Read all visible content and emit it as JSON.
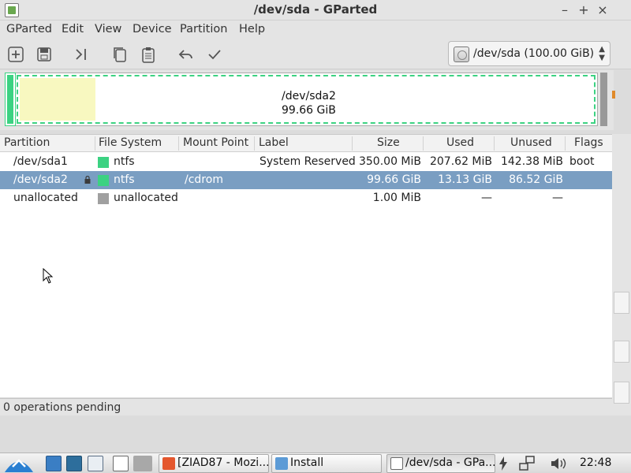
{
  "window": {
    "title": "/dev/sda - GParted",
    "buttons": [
      "–",
      "+",
      "×"
    ]
  },
  "menu": [
    "GParted",
    "Edit",
    "View",
    "Device",
    "Partition",
    "Help"
  ],
  "toolbar_icons": [
    "new-partition-icon",
    "delete-icon",
    "resize-icon",
    "copy-icon",
    "paste-icon",
    "undo-icon",
    "apply-icon"
  ],
  "device": {
    "selected": "/dev/sda  (100.00 GiB)"
  },
  "graphic": {
    "partition": "/dev/sda2",
    "size": "99.66 GiB",
    "used_fraction": 0.1317,
    "fill_color": "#f8f8c0",
    "border_color": "#3cd282"
  },
  "columns": [
    "Partition",
    "File System",
    "Mount Point",
    "Label",
    "Size",
    "Used",
    "Unused",
    "Flags"
  ],
  "rows": [
    {
      "partition": "/dev/sda1",
      "fs": "ntfs",
      "fs_color": "#3cd282",
      "mount": "",
      "label": "System Reserved",
      "size": "350.00 MiB",
      "used": "207.62 MiB",
      "unused": "142.38 MiB",
      "flags": "boot",
      "selected": false,
      "locked": false
    },
    {
      "partition": "/dev/sda2",
      "fs": "ntfs",
      "fs_color": "#3cd282",
      "mount": "/cdrom",
      "label": "",
      "size": "99.66 GiB",
      "used": "13.13 GiB",
      "unused": "86.52 GiB",
      "flags": "",
      "selected": true,
      "locked": true
    },
    {
      "partition": "unallocated",
      "fs": "unallocated",
      "fs_color": "#a0a0a0",
      "mount": "",
      "label": "",
      "size": "1.00 MiB",
      "used": "—",
      "unused": "—",
      "flags": "",
      "selected": false,
      "locked": false
    }
  ],
  "status": "0 operations pending",
  "taskbar": {
    "tasks": [
      {
        "label": "[ZIAD87 - Mozi...",
        "icon": "firefox-icon"
      },
      {
        "label": "Install",
        "icon": "install-icon"
      },
      {
        "label": "/dev/sda - GPa...",
        "icon": "gparted-icon"
      }
    ],
    "clock": "22:48"
  }
}
